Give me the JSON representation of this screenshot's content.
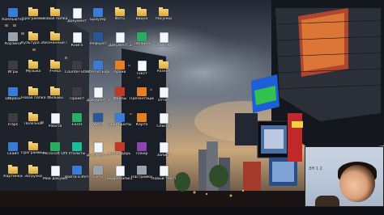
{
  "desktop": {
    "icons": [
      {
        "label": "Компьютер",
        "type": "app"
      },
      {
        "label": "Программы",
        "type": "folder"
      },
      {
        "label": "Новая папка",
        "type": "folder"
      },
      {
        "label": "Документ",
        "type": "doc"
      },
      {
        "label": "Браузер",
        "type": "app"
      },
      {
        "label": "Фото",
        "type": "folder"
      },
      {
        "label": "Видео",
        "type": "folder"
      },
      {
        "label": "Рисунки",
        "type": "folder"
      },
      {
        "label": "Корзина",
        "type": "grey"
      },
      {
        "label": "Культура 2015",
        "type": "folder"
      },
      {
        "label": "Скачанные файлы",
        "type": "folder"
      },
      {
        "label": "Книга",
        "type": "doc"
      },
      {
        "label": "Реферат",
        "type": "word"
      },
      {
        "label": "Документ 2",
        "type": "doc"
      },
      {
        "label": "Таблица",
        "type": "green"
      },
      {
        "label": "Заметки",
        "type": "doc"
      },
      {
        "label": "Игры",
        "type": "dark"
      },
      {
        "label": "Музыка",
        "type": "folder"
      },
      {
        "label": "Учеба",
        "type": "folder"
      },
      {
        "label": "Counter-Strike",
        "type": "dark"
      },
      {
        "label": "Internet Explorer",
        "type": "app"
      },
      {
        "label": "Архив",
        "type": "orange"
      },
      {
        "label": "Текст",
        "type": "doc"
      },
      {
        "label": "Разное",
        "type": "folder"
      },
      {
        "label": "Dropbox",
        "type": "app"
      },
      {
        "label": "Новая папка (2)",
        "type": "folder"
      },
      {
        "label": "Фильмы",
        "type": "folder"
      },
      {
        "label": "Проект",
        "type": "dark"
      },
      {
        "label": "Документ 3",
        "type": "doc"
      },
      {
        "label": "Файлы",
        "type": "red"
      },
      {
        "label": "Презентация",
        "type": "orange"
      },
      {
        "label": "Отчет",
        "type": "doc"
      },
      {
        "label": "Fraps",
        "type": "dark"
      },
      {
        "label": "Полезное",
        "type": "folder"
      },
      {
        "label": "Работа",
        "type": "doc"
      },
      {
        "label": "Excel",
        "type": "green"
      },
      {
        "label": "Word",
        "type": "word"
      },
      {
        "label": "Скриншоты",
        "type": "app"
      },
      {
        "label": "Карта",
        "type": "orange"
      },
      {
        "label": "Список",
        "type": "doc"
      },
      {
        "label": "Скайп",
        "type": "app"
      },
      {
        "label": "Программы 2",
        "type": "folder"
      },
      {
        "label": "Microsoft Office",
        "type": "green"
      },
      {
        "label": "Утилиты",
        "type": "teal"
      },
      {
        "label": "Документ 4",
        "type": "doc"
      },
      {
        "label": "Календарь",
        "type": "red"
      },
      {
        "label": "Плеер",
        "type": "purple"
      },
      {
        "label": "Записи",
        "type": "doc"
      },
      {
        "label": "Картинки",
        "type": "folder"
      },
      {
        "label": "Загрузки",
        "type": "folder"
      },
      {
        "label": "Мои документы",
        "type": "doc"
      },
      {
        "label": "Войти в Интернет",
        "type": "app"
      },
      {
        "label": "Сеть",
        "type": "grey"
      },
      {
        "label": "Видеозаписи",
        "type": "doc"
      },
      {
        "label": "Настройки",
        "type": "grey"
      },
      {
        "label": "Новый текст",
        "type": "doc"
      }
    ]
  },
  "webcam": {
    "wall_text": "ЭН 1 2"
  },
  "colors": {
    "sky_top": "#2b3140",
    "sky_glow": "#8a93a0",
    "sunset": "#c7a070",
    "building_dark": "#12151c",
    "billboard_blue": "#1c5fd6",
    "billboard_red": "#c0282a"
  }
}
